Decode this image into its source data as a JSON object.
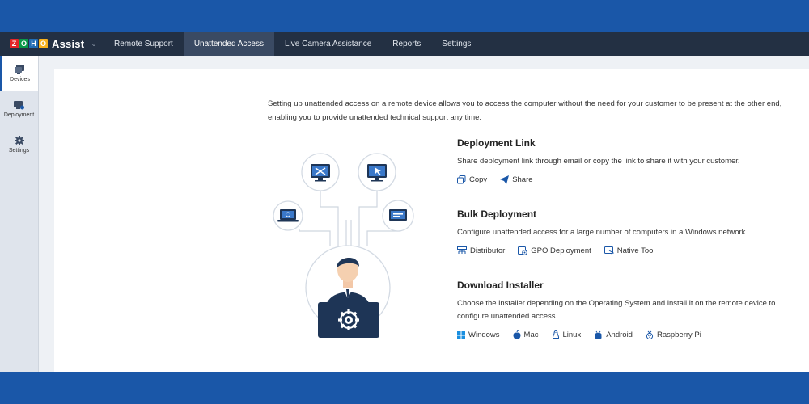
{
  "brand": {
    "logo_letters": [
      "Z",
      "O",
      "H",
      "O"
    ],
    "logo_colors": [
      "#e42527",
      "#089949",
      "#226db4",
      "#f9b21d"
    ],
    "name": "Assist"
  },
  "nav": {
    "tabs": [
      {
        "label": "Remote Support"
      },
      {
        "label": "Unattended Access"
      },
      {
        "label": "Live Camera Assistance"
      },
      {
        "label": "Reports"
      },
      {
        "label": "Settings"
      }
    ],
    "active": "Unattended Access"
  },
  "sidebar": {
    "items": [
      {
        "label": "Devices",
        "icon": "devices-icon"
      },
      {
        "label": "Deployment",
        "icon": "deployment-icon"
      },
      {
        "label": "Settings",
        "icon": "gear-icon"
      }
    ]
  },
  "intro": "Setting up unattended access on a remote device allows you to access the computer without the need for your customer to be present at the other end, enabling you to provide unattended technical support any time.",
  "sections": {
    "deployment_link": {
      "title": "Deployment Link",
      "description": "Share deployment link through email or copy the link to share it with your customer.",
      "actions": [
        {
          "label": "Copy",
          "icon": "copy-icon"
        },
        {
          "label": "Share",
          "icon": "send-icon"
        }
      ]
    },
    "bulk_deployment": {
      "title": "Bulk Deployment",
      "description": "Configure unattended access for a large number of computers in a Windows network.",
      "actions": [
        {
          "label": "Distributor",
          "icon": "distributor-icon"
        },
        {
          "label": "GPO Deployment",
          "icon": "gpo-icon"
        },
        {
          "label": "Native Tool",
          "icon": "native-tool-icon"
        }
      ]
    },
    "download_installer": {
      "title": "Download Installer",
      "description": "Choose the installer depending on the Operating System and install it on the remote device to configure unattended access.",
      "actions": [
        {
          "label": "Windows",
          "icon": "windows-icon"
        },
        {
          "label": "Mac",
          "icon": "apple-icon"
        },
        {
          "label": "Linux",
          "icon": "linux-icon"
        },
        {
          "label": "Android",
          "icon": "android-icon"
        },
        {
          "label": "Raspberry Pi",
          "icon": "raspberry-pi-icon"
        }
      ]
    }
  },
  "colors": {
    "band": "#1a57a8",
    "navbar": "#233043",
    "nav_active": "#3a4a63",
    "accent": "#1a57a8",
    "illustration_dark": "#1e3556"
  }
}
